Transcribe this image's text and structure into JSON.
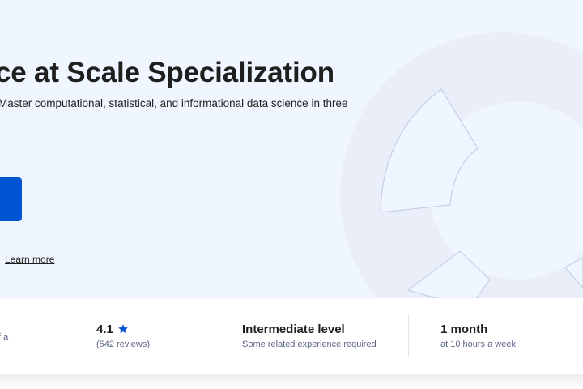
{
  "hero": {
    "title": "ce at Scale Specialization",
    "description": "Master computational, statistical, and informational data science in three",
    "learn_more": "Learn more"
  },
  "stats": [
    {
      "main": "",
      "sub": "f a"
    },
    {
      "main": "4.1",
      "sub": "(542 reviews)",
      "icon": "star-icon",
      "rating": 4.1
    },
    {
      "main": "Intermediate level",
      "sub": "Some related experience required"
    },
    {
      "main": "1 month",
      "sub": "at 10 hours a week"
    }
  ],
  "colors": {
    "accent": "#0056d2",
    "hero_background": "#f0f6ff",
    "star": "#0056d2",
    "subtext": "#5b6780"
  }
}
